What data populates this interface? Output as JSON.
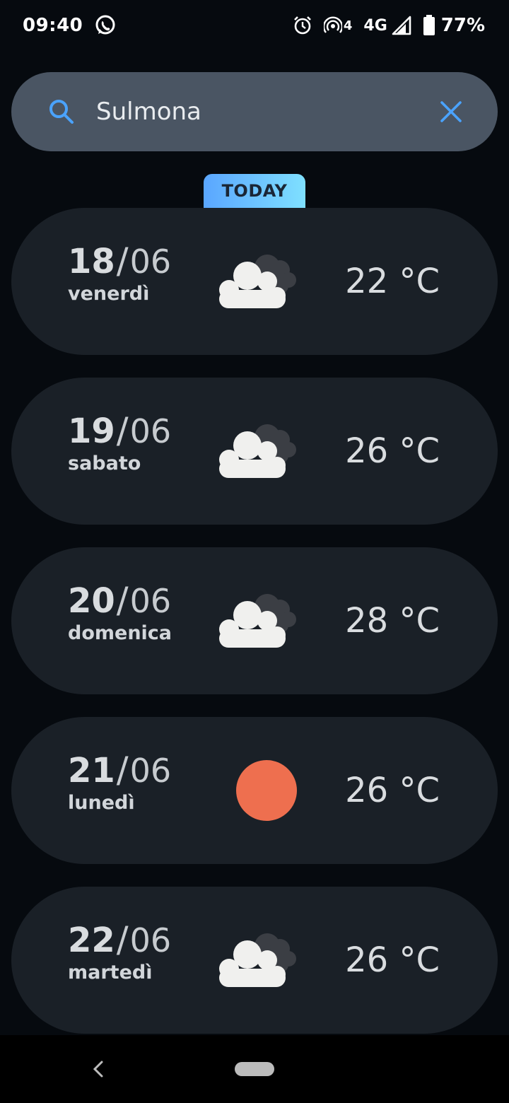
{
  "status_bar": {
    "time": "09:40",
    "network": "4G",
    "hotspot_badge": "4",
    "battery_percent": "77%",
    "icons": [
      "whatsapp-icon",
      "alarm-icon",
      "hotspot-icon",
      "signal-icon",
      "battery-icon"
    ]
  },
  "search": {
    "value": "Sulmona",
    "placeholder": "",
    "icons": [
      "search-icon",
      "clear-icon"
    ],
    "accent": "#4aa3ff"
  },
  "today_label": "TODAY",
  "forecast": [
    {
      "day": "18",
      "month": "06",
      "weekday": "venerdì",
      "temp": "22 °C",
      "icon": "cloudy-icon"
    },
    {
      "day": "19",
      "month": "06",
      "weekday": "sabato",
      "temp": "26 °C",
      "icon": "cloudy-icon"
    },
    {
      "day": "20",
      "month": "06",
      "weekday": "domenica",
      "temp": "28 °C",
      "icon": "cloudy-icon"
    },
    {
      "day": "21",
      "month": "06",
      "weekday": "lunedì",
      "temp": "26 °C",
      "icon": "sun-icon"
    },
    {
      "day": "22",
      "month": "06",
      "weekday": "martedì",
      "temp": "26 °C",
      "icon": "cloudy-icon"
    }
  ],
  "colors": {
    "background": "#060a0f",
    "card": "#1a2027",
    "search_bg": "#4a5563",
    "sun": "#ee6f4f",
    "cloud_front": "#f0f0ee",
    "cloud_back": "#3b3e44"
  },
  "nav": {
    "icons": [
      "back-icon",
      "home-pill-icon"
    ]
  }
}
